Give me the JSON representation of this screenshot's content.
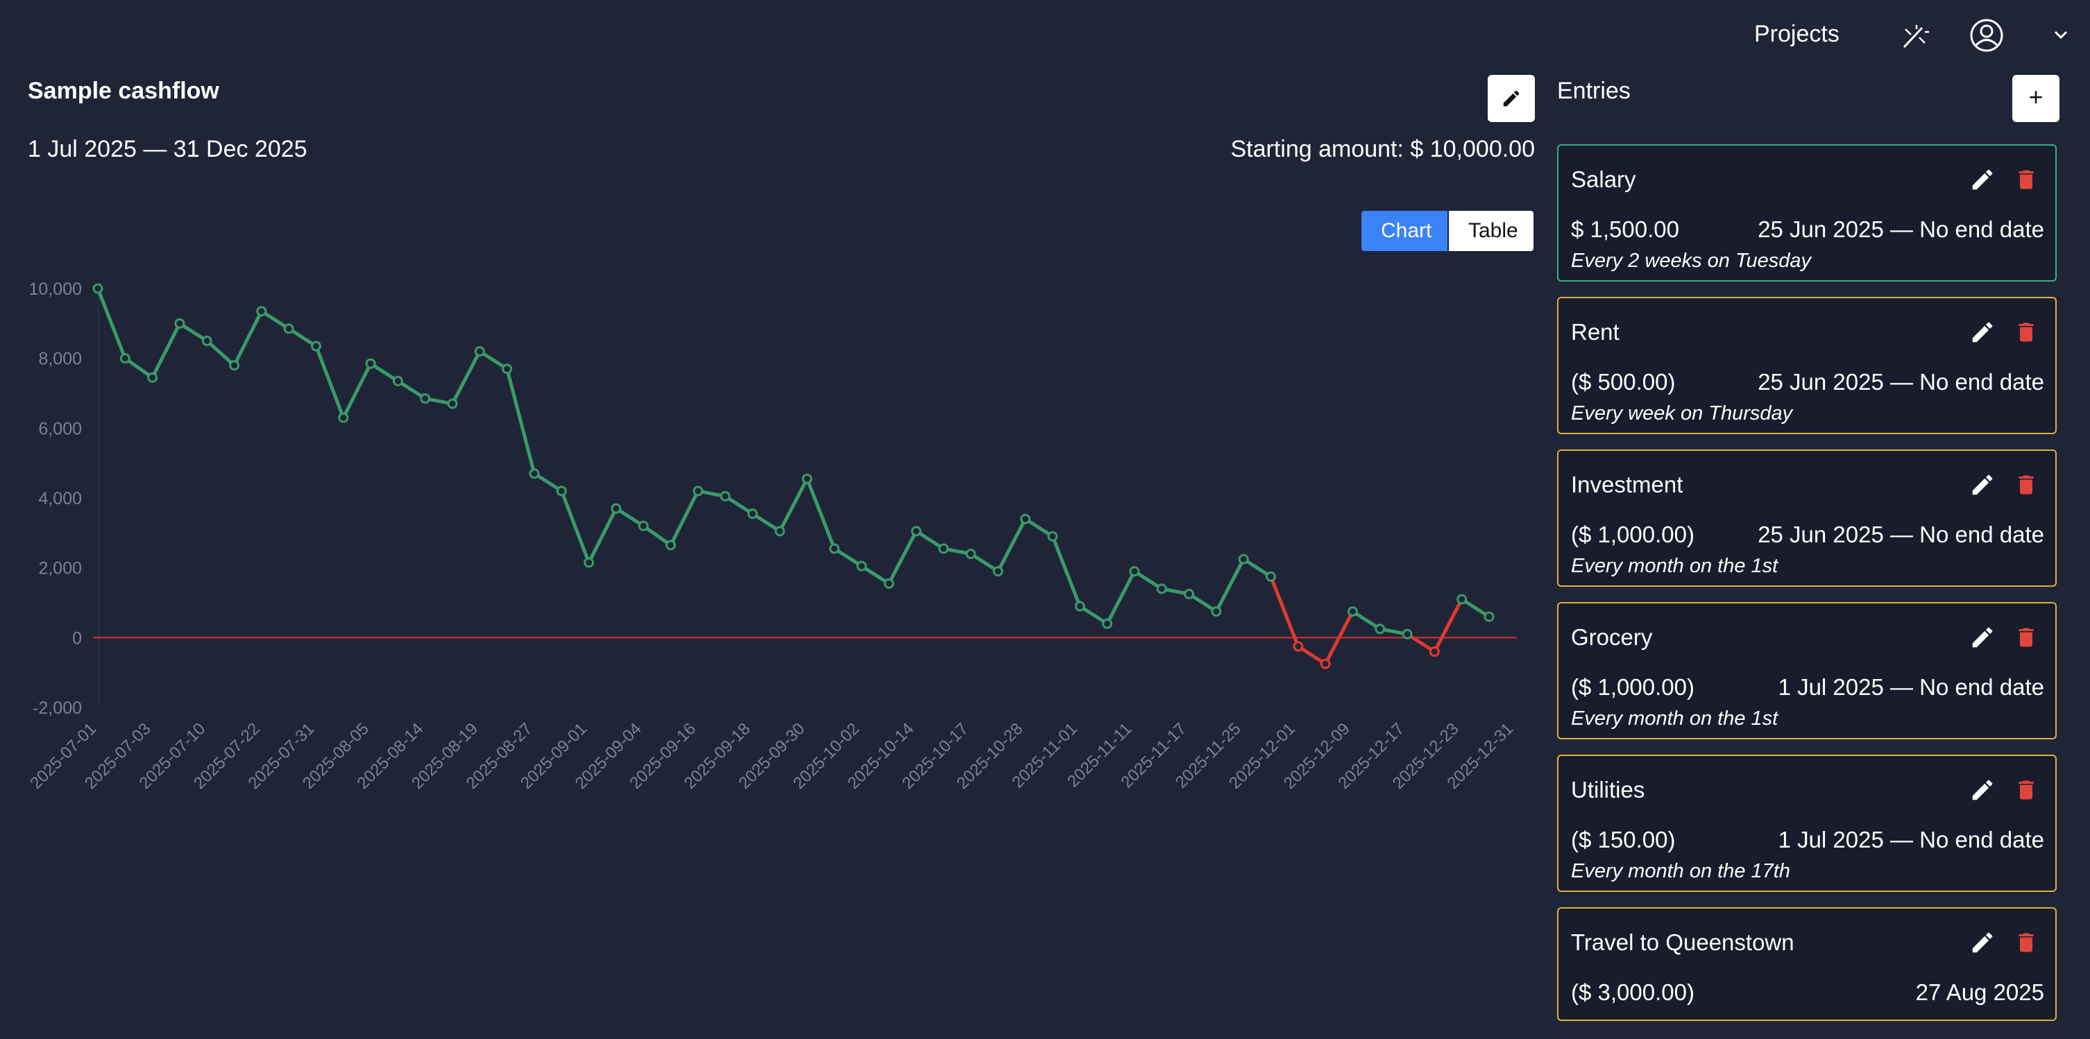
{
  "nav": {
    "projects_label": "Projects",
    "icons": [
      "magic-wand-icon",
      "user-avatar-icon",
      "chevron-down-icon"
    ]
  },
  "project": {
    "title": "Sample cashflow",
    "date_range": "1 Jul 2025 —  31 Dec 2025",
    "starting_amount": "Starting amount: $ 10,000.00"
  },
  "view_toggle": {
    "chart_label": "Chart",
    "table_label": "Table",
    "active": "Chart"
  },
  "colors": {
    "background": "#1f2537",
    "line_positive": "#3b9a6a",
    "line_negative": "#e03a2e",
    "zero_line": "#d93030",
    "accent_blue": "#3b82f6",
    "entry_border_income": "#2fb384",
    "entry_border_expense": "#e0b23a",
    "delete_red": "#e0463c"
  },
  "chart_data": {
    "type": "line",
    "title": "",
    "xlabel": "",
    "ylabel": "",
    "ylim": [
      -2000,
      10000
    ],
    "yticks": [
      10000,
      8000,
      6000,
      4000,
      2000,
      0,
      -2000
    ],
    "ytick_labels": [
      "10,000",
      "8,000",
      "6,000",
      "4,000",
      "2,000",
      "0",
      "-2,000"
    ],
    "grid": false,
    "x_tick_labels": [
      "2025-07-01",
      "2025-07-03",
      "2025-07-10",
      "2025-07-22",
      "2025-07-31",
      "2025-08-05",
      "2025-08-14",
      "2025-08-19",
      "2025-08-27",
      "2025-09-01",
      "2025-09-04",
      "2025-09-16",
      "2025-09-18",
      "2025-09-30",
      "2025-10-02",
      "2025-10-14",
      "2025-10-17",
      "2025-10-28",
      "2025-11-01",
      "2025-11-11",
      "2025-11-17",
      "2025-11-25",
      "2025-12-01",
      "2025-12-09",
      "2025-12-17",
      "2025-12-23",
      "2025-12-31"
    ],
    "values": [
      10000,
      8000,
      7450,
      9000,
      8500,
      7800,
      9350,
      8850,
      8350,
      6300,
      7850,
      7350,
      6850,
      6700,
      8200,
      7700,
      4700,
      4200,
      2150,
      3700,
      3200,
      2650,
      4200,
      4050,
      3550,
      3050,
      4550,
      2550,
      2050,
      1550,
      3050,
      2550,
      2400,
      1900,
      3400,
      2900,
      900,
      400,
      1900,
      1400,
      1250,
      750,
      2250,
      1750,
      -250,
      -750,
      750,
      250,
      100,
      -400,
      1100,
      600
    ]
  },
  "entries_panel": {
    "title": "Entries",
    "add_label": "+",
    "entries": [
      {
        "name": "Salary",
        "amount": "$ 1,500.00",
        "dates": "25 Jun 2025 — No end date",
        "frequency": "Every 2 weeks on Tuesday",
        "kind": "income"
      },
      {
        "name": "Rent",
        "amount": "($ 500.00)",
        "dates": "25 Jun 2025 — No end date",
        "frequency": "Every week on Thursday",
        "kind": "expense"
      },
      {
        "name": "Investment",
        "amount": "($ 1,000.00)",
        "dates": "25 Jun 2025 — No end date",
        "frequency": "Every month on the 1st",
        "kind": "expense"
      },
      {
        "name": "Grocery",
        "amount": "($ 1,000.00)",
        "dates": "1 Jul 2025 — No end date",
        "frequency": "Every month on the 1st",
        "kind": "expense"
      },
      {
        "name": "Utilities",
        "amount": "($ 150.00)",
        "dates": "1 Jul 2025 — No end date",
        "frequency": "Every month on the 17th",
        "kind": "expense"
      },
      {
        "name": "Travel to Queenstown",
        "amount": "($ 3,000.00)",
        "dates": "27 Aug 2025",
        "frequency": "",
        "kind": "expense"
      }
    ]
  }
}
